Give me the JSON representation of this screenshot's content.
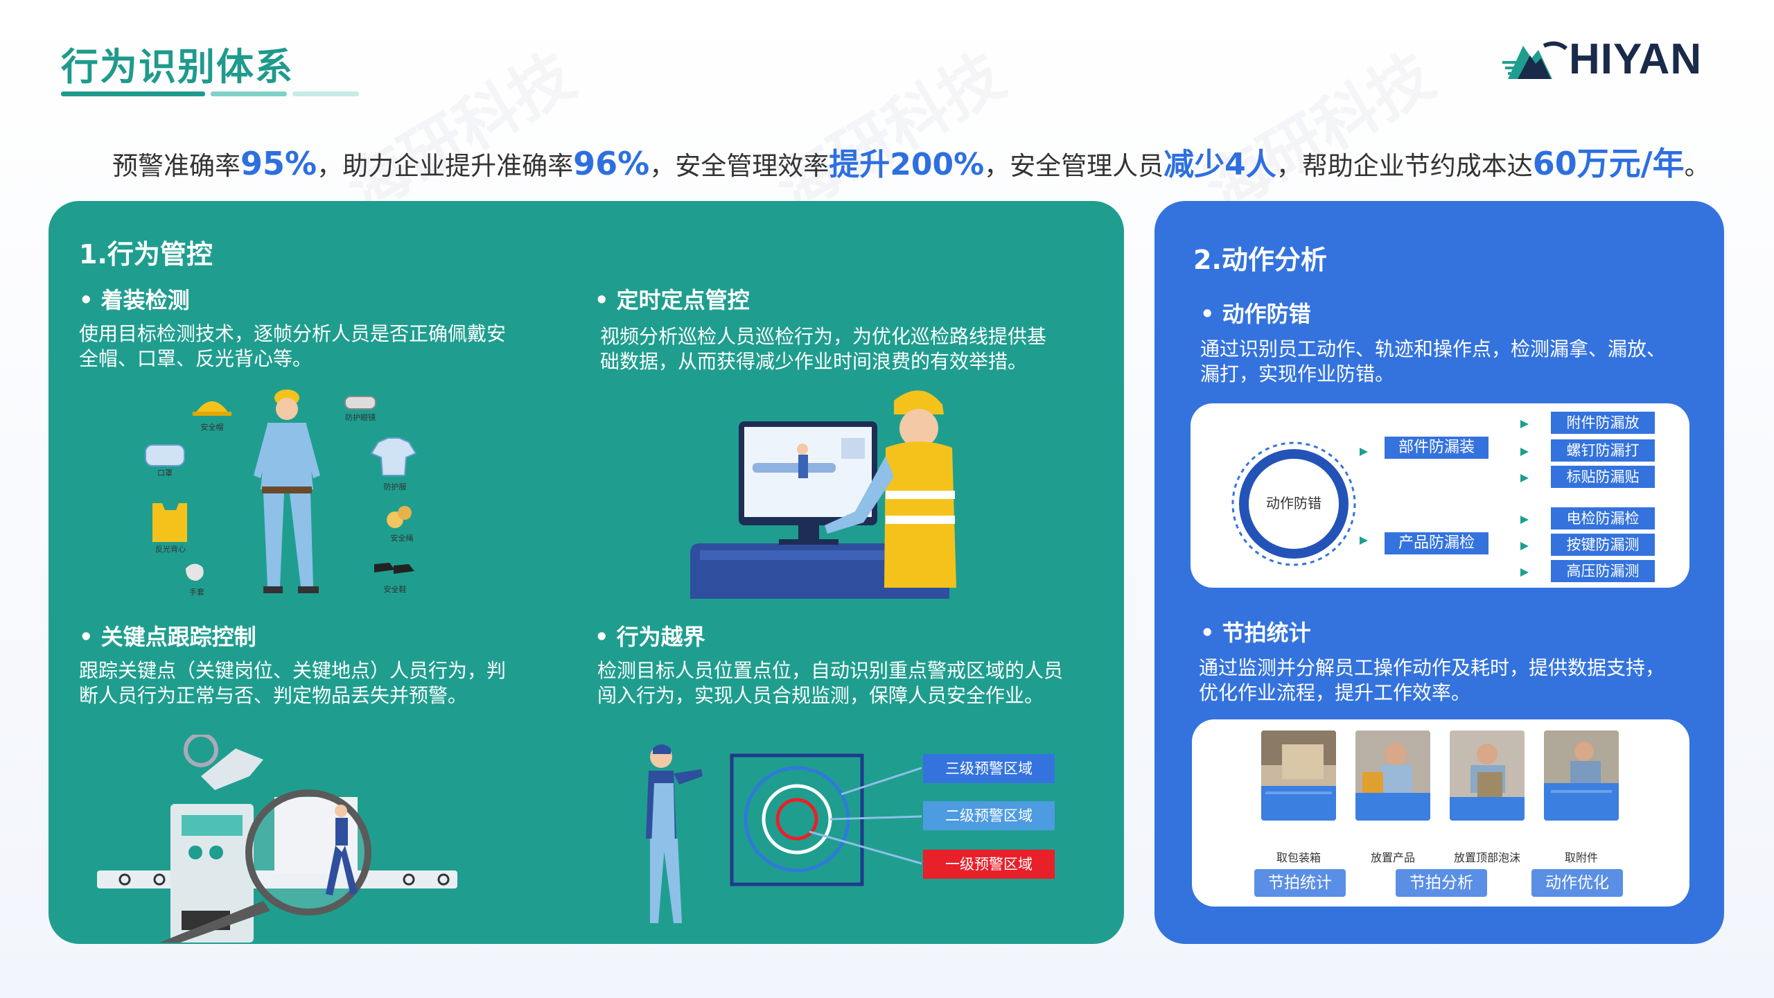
{
  "header": {
    "title": "行为识别体系",
    "logo_text": "HIYAN"
  },
  "summary": {
    "p1": "预警准确率",
    "v1": "95%",
    "p2": "，助力企业提升准确率",
    "v2": "96%",
    "p3": "，安全管理效率",
    "v3": "提升200%",
    "p4": "，安全管理人员",
    "v4": "减少4人",
    "p5": "，帮助企业节约成本达",
    "v5": "60万元/年",
    "p6": "。"
  },
  "watermark": "海研科技",
  "behavior_control": {
    "title": "1.行为管控",
    "dress": {
      "title": "着装检测",
      "desc_line1": "使用目标检测技术，逐帧分析人员是否正确佩戴安",
      "desc_line2": "全帽、口罩、反光背心等。"
    },
    "patrol": {
      "title": "定时定点管控",
      "desc_line1": "视频分析巡检人员巡检行为，为优化巡检路线提供基",
      "desc_line2": "础数据，从而获得减少作业时间浪费的有效举措。"
    },
    "keypoint": {
      "title": "关键点跟踪控制",
      "desc_line1": "跟踪关键点（关键岗位、关键地点）人员行为，判",
      "desc_line2": "断人员行为正常与否、判定物品丢失并预警。"
    },
    "boundary": {
      "title": "行为越界",
      "desc_line1": "检测目标人员位置点位，自动识别重点警戒区域的人员",
      "desc_line2": "闯入行为，实现人员合规监测，保障人员安全作业。",
      "zones": [
        "三级预警区域",
        "二级预警区域",
        "一级预警区域"
      ]
    }
  },
  "motion_analysis": {
    "title": "2.动作分析",
    "error_proof": {
      "title": "动作防错",
      "desc_line1": "通过识别员工动作、轨迹和操作点，检测漏拿、漏放、",
      "desc_line2": "漏打，实现作业防错。",
      "center": "动作防错",
      "branch1": "部件防漏装",
      "branch2": "产品防漏检",
      "leaves1": [
        "附件防漏放",
        "螺钉防漏打",
        "标贴防漏贴"
      ],
      "leaves2": [
        "电检防漏检",
        "按键防漏测",
        "高压防漏测"
      ]
    },
    "takt": {
      "title": "节拍统计",
      "desc_line1": "通过监测并分解员工操作动作及耗时，提供数据支持，",
      "desc_line2": "优化作业流程，提升工作效率。",
      "photos": [
        "取包装箱",
        "放置产品",
        "放置顶部泡沫",
        "取附件"
      ],
      "buttons": [
        "节拍统计",
        "节拍分析",
        "动作优化"
      ]
    }
  },
  "colors": {
    "green": "#1f9e8f",
    "blue": "#3473de",
    "title": "#1f9a8d",
    "highlight": "#2e6fe0",
    "red": "#e8202a"
  }
}
